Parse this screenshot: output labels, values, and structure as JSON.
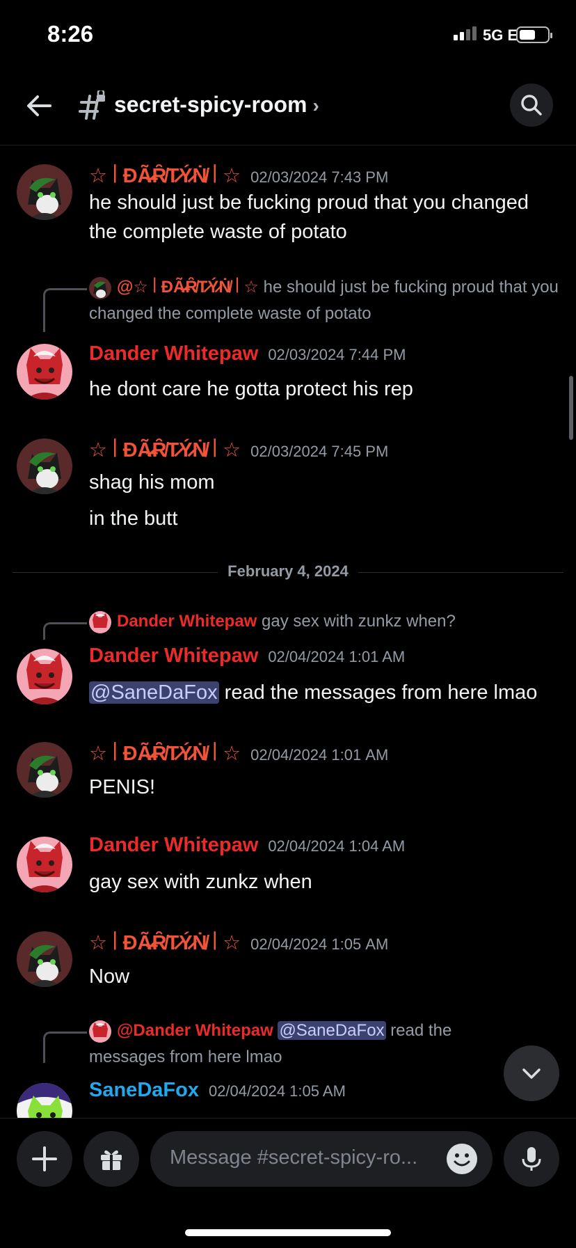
{
  "status_bar": {
    "time": "8:26",
    "network": "5G E"
  },
  "header": {
    "channel_name": "secret-spicy-room",
    "chevron": "›"
  },
  "messages": [
    {
      "author": "☆꒐ĐÃ̶̷Ȓ̸T̷Ý̷Ṅ̸꒐☆",
      "timestamp": "02/03/2024 7:43 PM",
      "lines": [
        "he should just be fucking proud that you changed the complete waste of potato"
      ]
    },
    {
      "reply_author": "@☆꒐ĐÃ̶̷Ȓ̸T̷Ý̷Ṅ̸꒐☆",
      "reply_text": "he should just be fucking proud that you changed the complete waste of potato",
      "author": "Dander Whitepaw",
      "timestamp": "02/03/2024 7:44 PM",
      "lines": [
        "he dont care he gotta protect his rep"
      ]
    },
    {
      "author": "☆꒐ĐÃ̶̷Ȓ̸T̷Ý̷Ṅ̸꒐☆",
      "timestamp": "02/03/2024 7:45 PM",
      "lines": [
        "shag his mom",
        "in the butt"
      ]
    },
    {
      "reply_author": "Dander Whitepaw",
      "reply_text": "gay sex with zunkz when?",
      "author": "Dander Whitepaw",
      "timestamp": "02/04/2024 1:01 AM",
      "mention": "@SaneDaFox",
      "lines": [
        "read the messages from here lmao"
      ]
    },
    {
      "author": "☆꒐ĐÃ̶̷Ȓ̸T̷Ý̷Ṅ̸꒐☆",
      "timestamp": "02/04/2024 1:01 AM",
      "lines": [
        "PENIS!"
      ]
    },
    {
      "author": "Dander Whitepaw",
      "timestamp": "02/04/2024 1:04 AM",
      "lines": [
        "gay sex with zunkz when"
      ]
    },
    {
      "author": "☆꒐ĐÃ̶̷Ȓ̸T̷Ý̷Ṅ̸꒐☆",
      "timestamp": "02/04/2024 1:05 AM",
      "lines": [
        "Now"
      ]
    },
    {
      "reply_author": "@Dander Whitepaw",
      "reply_mention": "@SaneDaFox",
      "reply_text": "read the messages from here lmao",
      "author": "SaneDaFox",
      "timestamp": "02/04/2024 1:05 AM",
      "lines": []
    }
  ],
  "date_divider": "February 4, 2024",
  "composer": {
    "placeholder": "Message #secret-spicy-ro..."
  },
  "colors": {
    "party_name": "#f0523a",
    "dander_name": "#ed2a2a",
    "sane_name": "#21a9f0",
    "mention_bg": "#3c4270",
    "background": "#000000"
  },
  "icons": [
    "back-arrow-icon",
    "channel-hash-icon",
    "search-icon",
    "chevron-down-icon",
    "plus-icon",
    "gift-icon",
    "emoji-icon",
    "microphone-icon"
  ]
}
